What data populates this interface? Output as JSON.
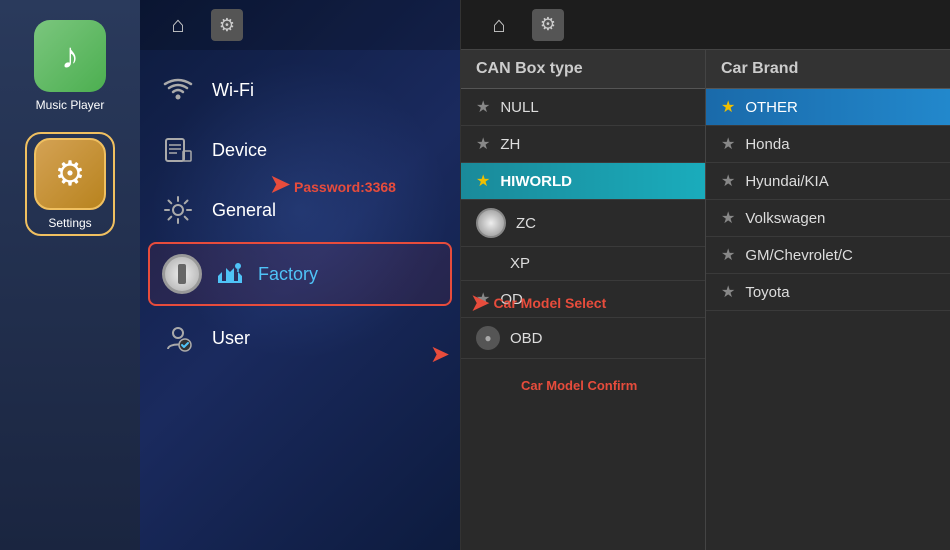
{
  "sidebar": {
    "apps": [
      {
        "id": "music-player",
        "label": "Music Player",
        "icon": "♪",
        "iconBg": "music"
      },
      {
        "id": "settings",
        "label": "Settings",
        "icon": "⚙",
        "iconBg": "settings",
        "active": true
      }
    ]
  },
  "middle": {
    "topbar": {
      "home_icon": "⌂",
      "settings_icon": "⚙"
    },
    "menu": [
      {
        "id": "wifi",
        "icon": "📶",
        "label": "Wi-Fi"
      },
      {
        "id": "device",
        "icon": "📱",
        "label": "Device"
      },
      {
        "id": "general",
        "icon": "⚙",
        "label": "General"
      },
      {
        "id": "factory",
        "icon": "🔧",
        "label": "Factory",
        "active": true
      },
      {
        "id": "user",
        "icon": "👤",
        "label": "User"
      }
    ],
    "annotations": {
      "password": "Password:3368",
      "car_model_select": "Car Model Select",
      "car_model_confirm": "Car Model Confirm"
    }
  },
  "right": {
    "topbar": {
      "home_icon": "⌂",
      "settings_icon": "⚙"
    },
    "can_box": {
      "header": "CAN Box type",
      "items": [
        {
          "id": "null",
          "label": "NULL",
          "star": true,
          "selected": false
        },
        {
          "id": "zh",
          "label": "ZH",
          "star": true,
          "selected": false
        },
        {
          "id": "hiworld",
          "label": "HIWORLD",
          "star": true,
          "selected": true
        },
        {
          "id": "zc",
          "label": "ZC",
          "star": false,
          "toggle": true,
          "selected": false
        },
        {
          "id": "xp",
          "label": "XP",
          "star": false,
          "selected": false
        },
        {
          "id": "od",
          "label": "OD",
          "star": true,
          "selected": false
        },
        {
          "id": "obd",
          "label": "OBD",
          "star": false,
          "obd": true,
          "selected": false
        }
      ]
    },
    "car_brand": {
      "header": "Car Brand",
      "items": [
        {
          "id": "other",
          "label": "OTHER",
          "star": true,
          "selected": true
        },
        {
          "id": "honda",
          "label": "Honda",
          "star": true,
          "selected": false
        },
        {
          "id": "hyundai",
          "label": "Hyundai/KIA",
          "star": true,
          "selected": false
        },
        {
          "id": "volkswagen",
          "label": "Volkswagen",
          "star": true,
          "selected": false
        },
        {
          "id": "gm",
          "label": "GM/Chevrolet/C",
          "star": true,
          "selected": false
        },
        {
          "id": "toyota",
          "label": "Toyota",
          "star": true,
          "selected": false
        }
      ]
    }
  }
}
